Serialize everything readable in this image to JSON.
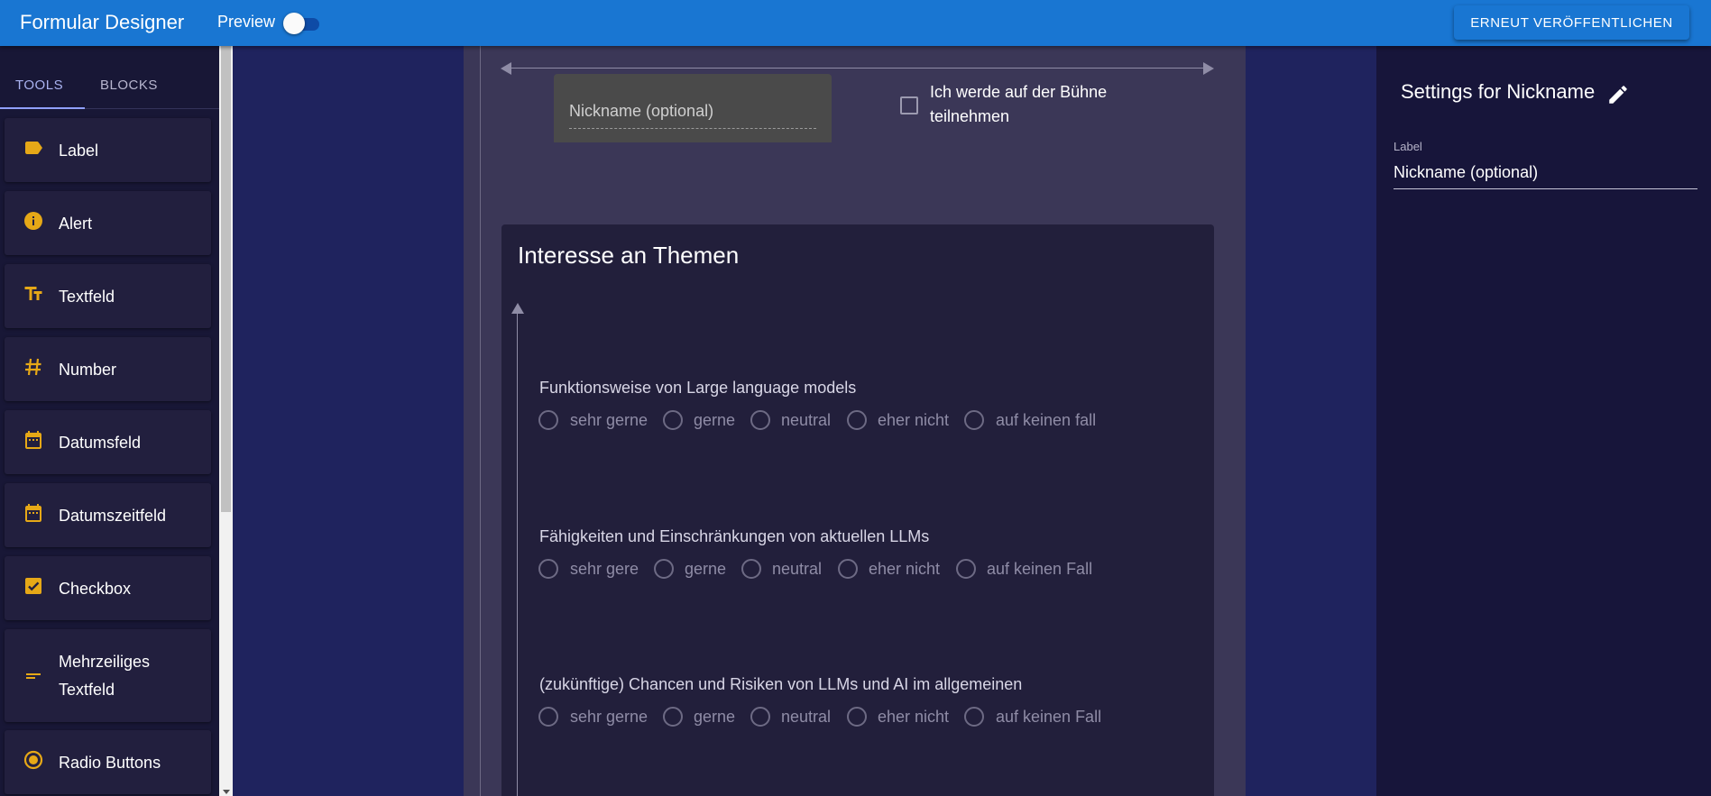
{
  "appbar": {
    "title": "Formular Designer",
    "preview_label": "Preview",
    "preview_enabled": false,
    "publish_label": "ERNEUT VERÖFFENTLICHEN",
    "color": "#1976d2"
  },
  "sidebar": {
    "tabs": [
      {
        "label": "TOOLS",
        "active": true
      },
      {
        "label": "BLOCKS",
        "active": false
      }
    ],
    "tools": [
      {
        "label": "Label",
        "icon": "label-icon"
      },
      {
        "label": "Alert",
        "icon": "info-icon"
      },
      {
        "label": "Textfeld",
        "icon": "text-fields-icon"
      },
      {
        "label": "Number",
        "icon": "hash-icon"
      },
      {
        "label": "Datumsfeld",
        "icon": "calendar-icon"
      },
      {
        "label": "Datumszeitfeld",
        "icon": "calendar-icon"
      },
      {
        "label": "Checkbox",
        "icon": "checkbox-icon"
      },
      {
        "label": "Mehrzeiliges Textfeld",
        "icon": "multiline-icon"
      },
      {
        "label": "Radio Buttons",
        "icon": "radio-button-icon"
      }
    ],
    "icon_color": "#e6a817"
  },
  "form": {
    "nickname_field": {
      "label": "Nickname (optional)"
    },
    "stage_checkbox": {
      "label": "Ich werde auf der Bühne teilnehmen",
      "checked": false
    },
    "interest_section": {
      "title": "Interesse an Themen",
      "questions": [
        {
          "label": "Funktionsweise von Large language models",
          "options": [
            "sehr gerne",
            "gerne",
            "neutral",
            "eher nicht",
            "auf keinen fall"
          ]
        },
        {
          "label": "Fähigkeiten und Einschränkungen von aktuellen LLMs",
          "options": [
            "sehr gere",
            "gerne",
            "neutral",
            "eher nicht",
            "auf keinen Fall"
          ]
        },
        {
          "label": "(zukünftige) Chancen und Risiken von LLMs und AI im allgemeinen",
          "options": [
            "sehr gerne",
            "gerne",
            "neutral",
            "eher nicht",
            "auf keinen Fall"
          ]
        }
      ]
    }
  },
  "settings": {
    "title": "Settings for Nickname",
    "label_caption": "Label",
    "label_value": "Nickname (optional)"
  }
}
